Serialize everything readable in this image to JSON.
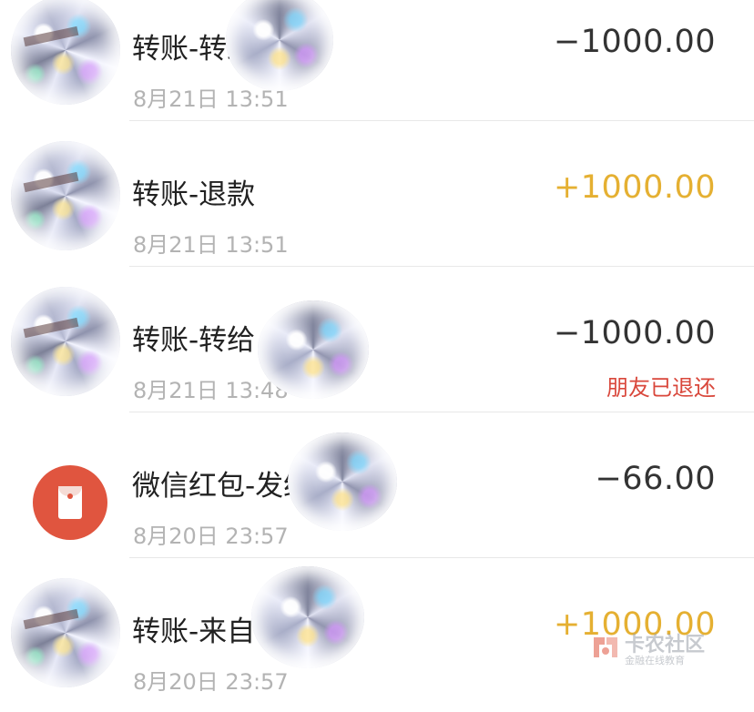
{
  "transactions": [
    {
      "title": "转账-转给",
      "time": "8月21日 13:51",
      "amount": "−1000.00",
      "note": "",
      "direction": "out",
      "icon": "glitter-avatar"
    },
    {
      "title": "转账-退款",
      "time": "8月21日 13:51",
      "amount": "+1000.00",
      "note": "",
      "direction": "in",
      "icon": "glitter-avatar"
    },
    {
      "title": "转账-转给",
      "time": "8月21日 13:48",
      "amount": "−1000.00",
      "note": "朋友已退还",
      "direction": "out",
      "icon": "glitter-avatar"
    },
    {
      "title": "微信红包-发给",
      "time": "8月20日 23:57",
      "amount": "−66.00",
      "note": "",
      "direction": "out",
      "icon": "red-packet-icon"
    },
    {
      "title": "转账-来自",
      "time": "8月20日 23:57",
      "amount": "+1000.00",
      "note": "",
      "direction": "in",
      "icon": "glitter-avatar"
    }
  ],
  "colors": {
    "income": "#e5b032",
    "expense": "#333333",
    "note": "#d9473b",
    "red_packet": "#e0553f"
  },
  "watermark": {
    "name": "卡农社区",
    "tagline": "金融在线教育"
  }
}
